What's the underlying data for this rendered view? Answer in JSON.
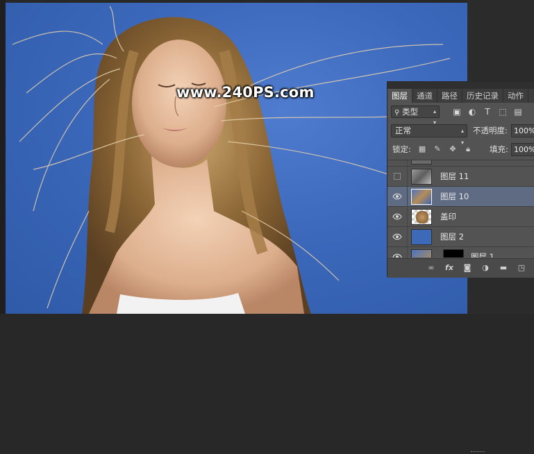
{
  "watermark": "www.240PS.com",
  "panel": {
    "tabs": [
      "图层",
      "通道",
      "路径",
      "历史记录",
      "动作"
    ],
    "filter": {
      "label": "类型",
      "icon": "search-icon"
    },
    "filter_icons": [
      "image-filter-icon",
      "adjustment-filter-icon",
      "text-filter-icon",
      "shape-filter-icon",
      "smart-object-filter-icon"
    ],
    "blend_mode": "正常",
    "opacity_label": "不透明度:",
    "opacity_value": "100%",
    "lock_label": "锁定:",
    "fill_label": "填充:",
    "fill_value": "100%",
    "layers": [
      {
        "name": "图层 11",
        "visible": false,
        "selected": false
      },
      {
        "name": "图层 10",
        "visible": true,
        "selected": true
      },
      {
        "name": "盖印",
        "visible": true,
        "selected": false
      },
      {
        "name": "图层 2",
        "visible": true,
        "selected": false,
        "fill_color": "#3d6ab8"
      },
      {
        "name": "图层 1",
        "visible": true,
        "selected": false
      }
    ],
    "footer_icons": [
      "link-icon",
      "fx-icon",
      "mask-icon",
      "adjustment-icon",
      "folder-icon",
      "new-layer-icon"
    ]
  },
  "colors": {
    "sky": "#3c68bb",
    "panel_bg": "#535353",
    "selected_row": "#5e6b83"
  }
}
